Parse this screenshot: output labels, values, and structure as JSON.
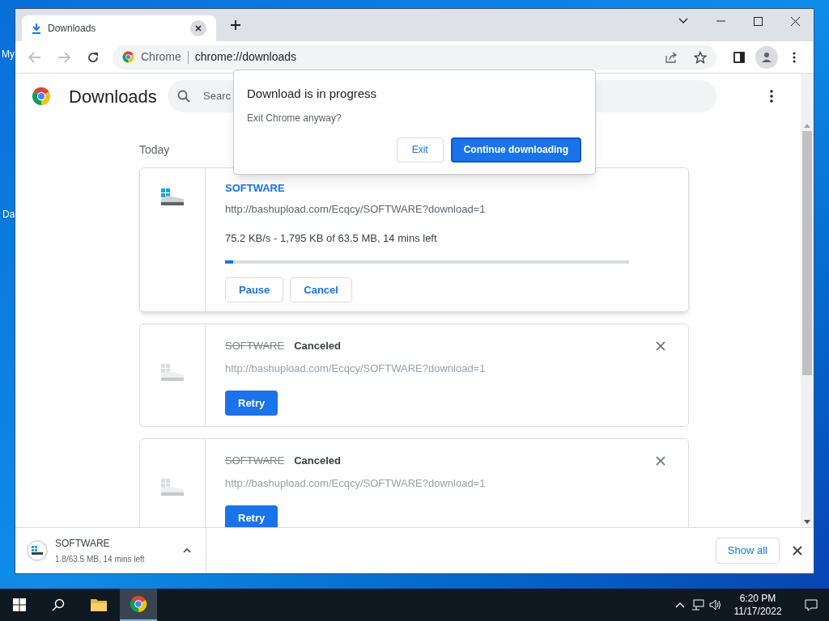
{
  "desktop_icons": [
    {
      "label": "My"
    },
    {
      "label": "Da"
    }
  ],
  "tabs": [
    {
      "title": "Downloads",
      "selected": true
    }
  ],
  "omnibox": {
    "site": "Chrome",
    "url": "chrome://downloads"
  },
  "page": {
    "title": "Downloads",
    "search_placeholder": "Searc",
    "date": "Today"
  },
  "downloads": [
    {
      "kind": "active",
      "name": "SOFTWARE",
      "url": "http://bashupload.com/Ecqcy/SOFTWARE?download=1",
      "status": "75.2 KB/s - 1,795 KB of 63.5 MB, 14 mins left",
      "level": 0.02,
      "buttons": [
        "Pause",
        "Cancel"
      ]
    },
    {
      "kind": "canceled",
      "name": "SOFTWARE",
      "status": "Canceled",
      "url": "http://bashupload.com/Ecqcy/SOFTWARE?download=1",
      "buttons": [
        "Retry"
      ]
    },
    {
      "kind": "canceled",
      "name": "SOFTWARE",
      "status": "Canceled",
      "url": "http://bashupload.com/Ecqcy/SOFTWARE?download=1",
      "buttons": [
        "Retry"
      ]
    }
  ],
  "dialog": {
    "title": "Download is in progress",
    "message": "Exit Chrome anyway?",
    "buttons": [
      {
        "label": "Exit",
        "primary": false
      },
      {
        "label": "Continue downloading",
        "primary": true
      }
    ]
  },
  "shelf": {
    "name": "SOFTWARE",
    "status": "1.8/63.5 MB, 14 mins left",
    "show_all": "Show all"
  },
  "taskbar": {
    "time": "6:20 PM",
    "date": "11/17/2022"
  }
}
